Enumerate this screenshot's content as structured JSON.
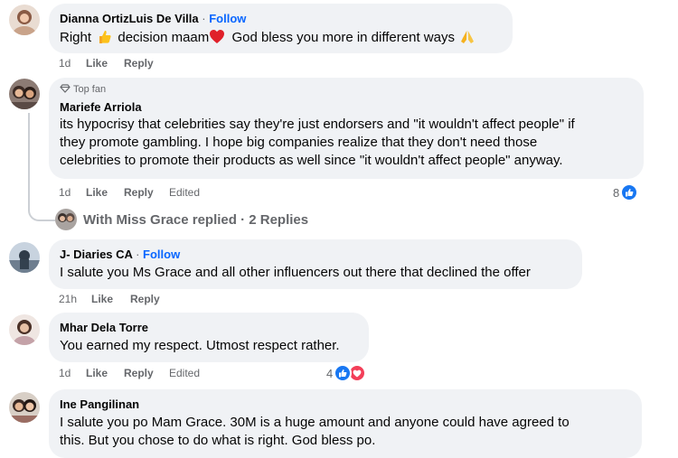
{
  "comments": [
    {
      "name": "Dianna OrtizLuis De Villa",
      "follow": "Follow",
      "sep": "·",
      "text_1": "Right",
      "text_2": "decision maam",
      "text_3": "God bless you more in different ways",
      "time": "1d",
      "like": "Like",
      "reply": "Reply"
    },
    {
      "badge": "Top fan",
      "name": "Mariefe Arriola",
      "lines": [
        "its hypocrisy that celebrities say they're just endorsers and \"it wouldn't affect people\" if",
        "they promote gambling. I hope big companies realize that they don't need those",
        "celebrities to promote their products as well since \"it wouldn't affect people\" anyway."
      ],
      "time": "1d",
      "like": "Like",
      "reply": "Reply",
      "edited": "Edited",
      "reaction_count": "8",
      "replies_text": "With Miss Grace replied · 2 Replies"
    },
    {
      "name": "J- Diaries CA",
      "follow": "Follow",
      "sep": "·",
      "text": "I salute you Ms Grace and all other influencers out there that declined the offer",
      "time": "21h",
      "like": "Like",
      "reply": "Reply"
    },
    {
      "name": "Mhar Dela Torre",
      "text": "You earned my respect. Utmost respect rather.",
      "time": "1d",
      "like": "Like",
      "reply": "Reply",
      "edited": "Edited",
      "reaction_count": "4"
    },
    {
      "name": "Ine Pangilinan",
      "lines": [
        "I salute you po Mam Grace. 30M is a huge amount and anyone could have agreed to",
        "this. But you chose to do what is right. God bless po."
      ]
    }
  ],
  "colors": {
    "bubble": "#f0f2f5",
    "link": "#0866ff",
    "meta": "#65676b",
    "like_reaction": "#1877f2",
    "love_reaction": "#f33e58"
  }
}
